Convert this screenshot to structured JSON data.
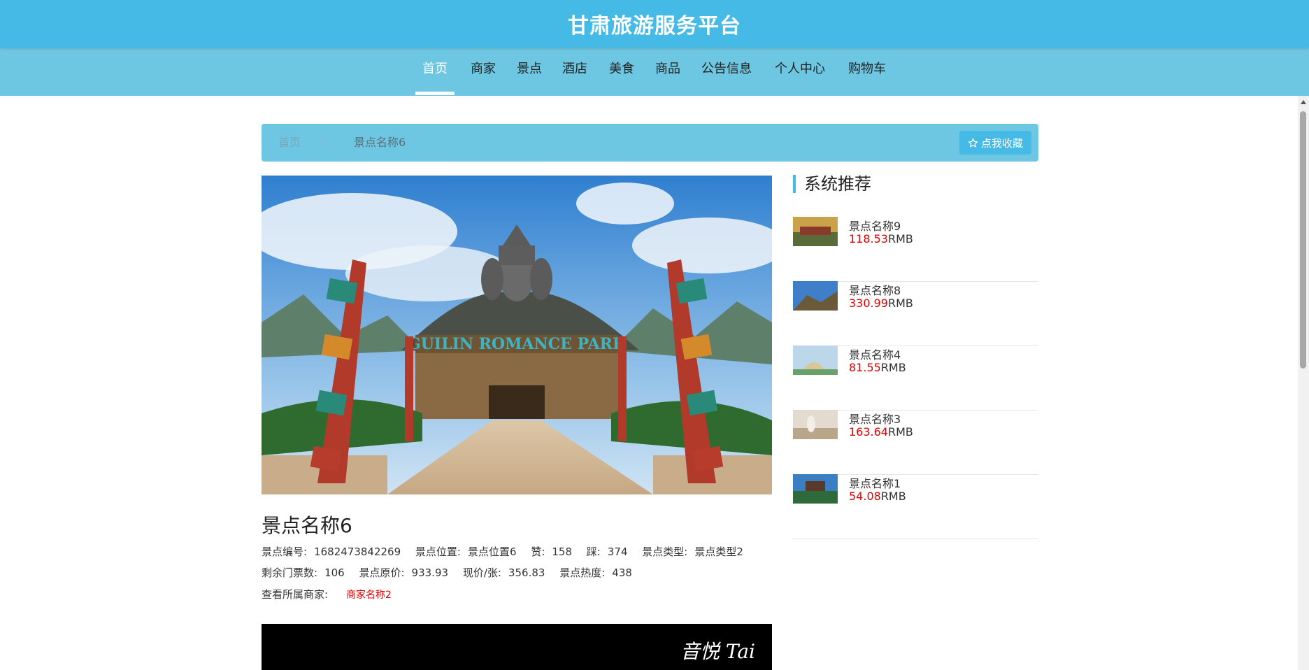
{
  "site": {
    "title": "甘肃旅游服务平台"
  },
  "nav": {
    "items": [
      {
        "label": "首页",
        "active": true
      },
      {
        "label": "商家"
      },
      {
        "label": "景点"
      },
      {
        "label": "酒店"
      },
      {
        "label": "美食"
      },
      {
        "label": "商品"
      },
      {
        "label": "公告信息"
      },
      {
        "label": "个人中心"
      },
      {
        "label": "购物车"
      }
    ]
  },
  "breadcrumb": {
    "home": "首页",
    "separator": "/",
    "current": "景点名称6"
  },
  "favorite_button": {
    "icon": "star-outline-icon",
    "label": "点我收藏"
  },
  "detail": {
    "title": "景点名称6",
    "image_sign_text": "GUILIN ROMANCE PARK",
    "fields_row1": [
      {
        "label": "景点编号:",
        "value": "1682473842269"
      },
      {
        "label": "景点位置:",
        "value": "景点位置6"
      },
      {
        "label": "赞:",
        "value": "158"
      },
      {
        "label": "踩:",
        "value": "374"
      },
      {
        "label": "景点类型:",
        "value": "景点类型2"
      }
    ],
    "fields_row2": [
      {
        "label": "剩余门票数:",
        "value": "106"
      },
      {
        "label": "景点原价:",
        "value": "933.93"
      },
      {
        "label": "现价/张:",
        "value": "356.83"
      },
      {
        "label": "景点热度:",
        "value": "438"
      }
    ],
    "merchant_label": "查看所属商家:",
    "merchant_link": "商家名称2",
    "video_watermark": "音悦 Tai"
  },
  "recommend": {
    "title": "系统推荐",
    "items": [
      {
        "name": "景点名称9",
        "price": "118.53",
        "unit": "RMB"
      },
      {
        "name": "景点名称8",
        "price": "330.99",
        "unit": "RMB"
      },
      {
        "name": "景点名称4",
        "price": "81.55",
        "unit": "RMB"
      },
      {
        "name": "景点名称3",
        "price": "163.64",
        "unit": "RMB"
      },
      {
        "name": "景点名称1",
        "price": "54.08",
        "unit": "RMB"
      }
    ]
  },
  "colors": {
    "primary": "#45bae6",
    "nav_bg": "#6dc7e2",
    "price": "#e00000"
  }
}
